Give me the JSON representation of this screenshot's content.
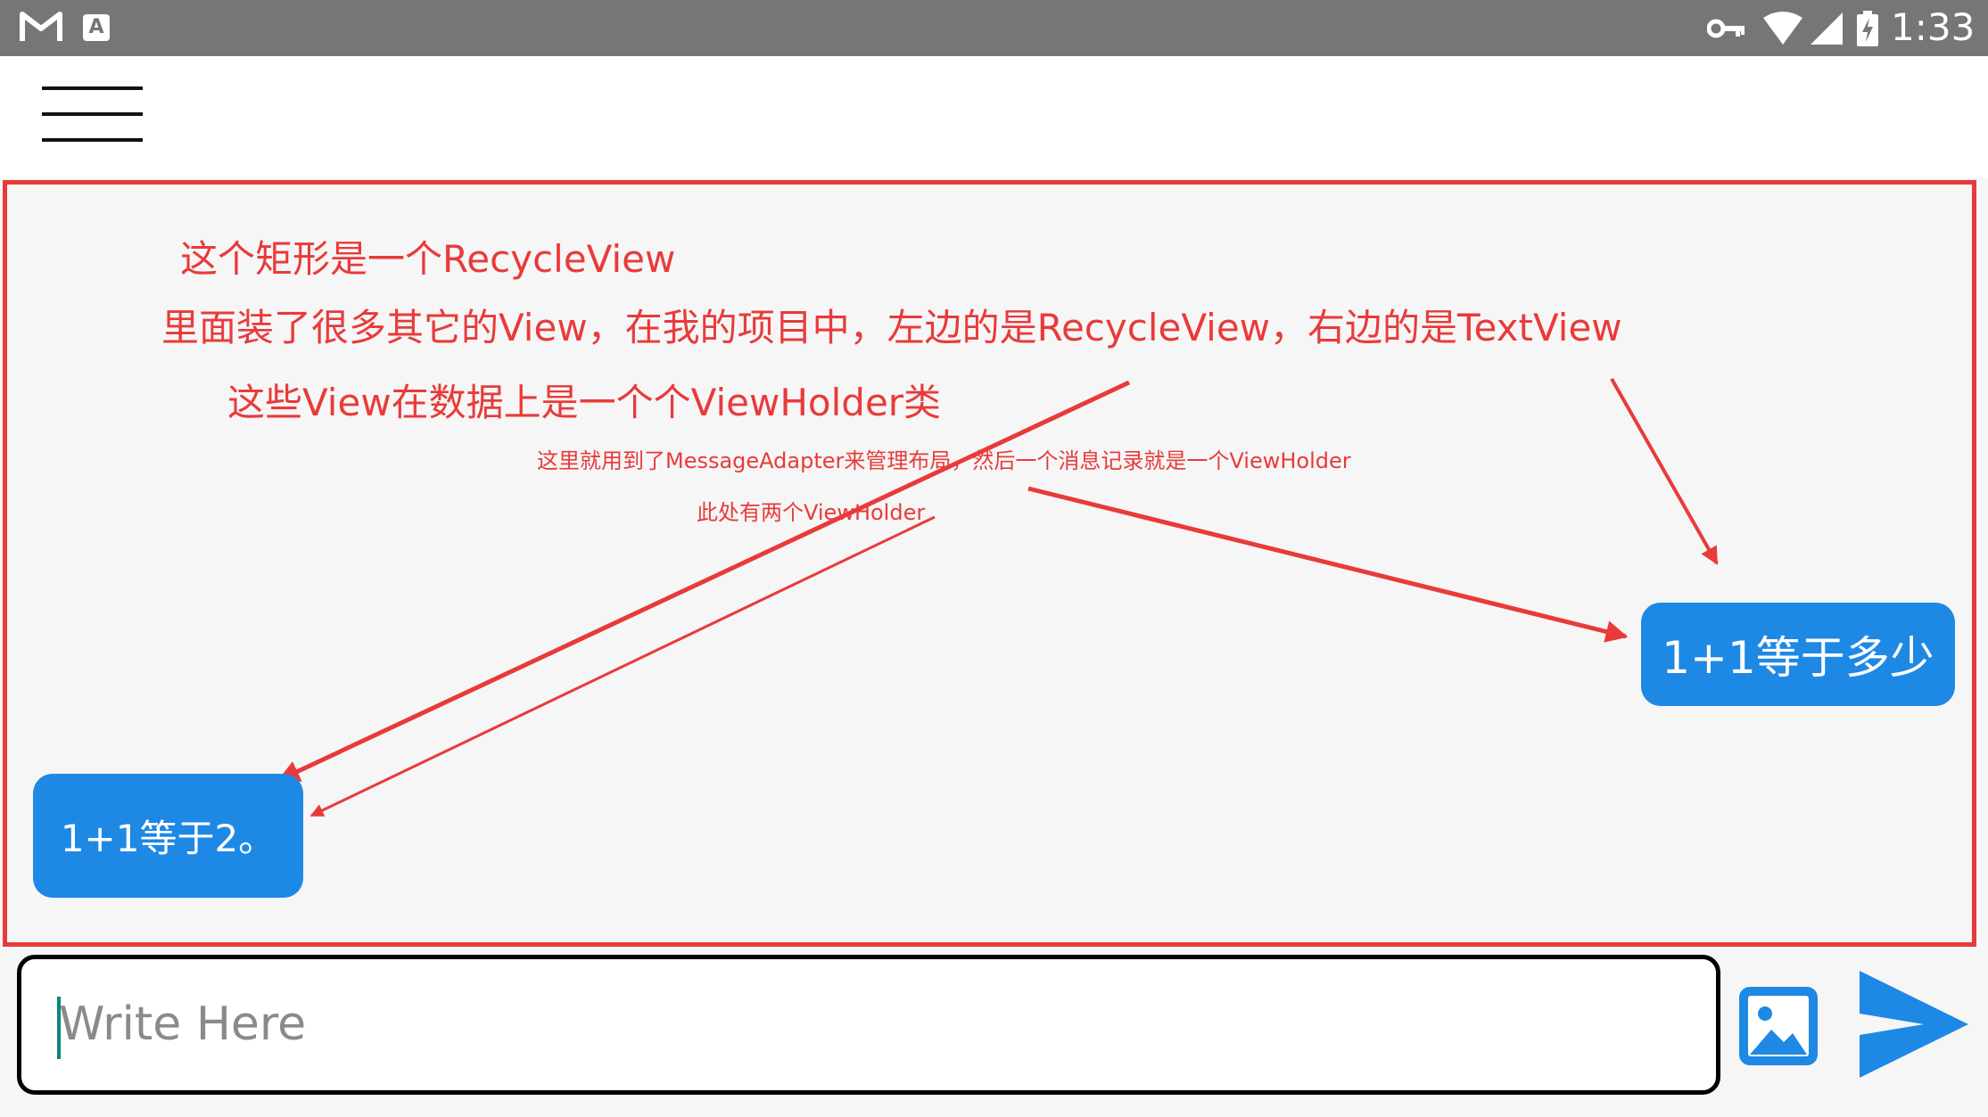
{
  "status_bar": {
    "time": "1:33",
    "notification_icons": [
      "gmail-icon",
      "text-a-icon"
    ],
    "system_icons": [
      "key-icon",
      "wifi-icon",
      "cell-signal-icon",
      "battery-charging-icon"
    ],
    "background_color": "#767676"
  },
  "toolbar": {
    "menu_icon": "hamburger-menu-icon"
  },
  "annotations": {
    "title": "这个矩形是一个RecycleView",
    "line2": "里面装了很多其它的View，在我的项目中，左边的是RecycleView，右边的是TextView",
    "line3": "这些View在数据上是一个个ViewHolder类",
    "note1": "这里就用到了MessageAdapter来管理布局，然后一个消息记录就是一个ViewHolder",
    "note2": "此处有两个ViewHolder",
    "color": "#e93a3a"
  },
  "messages": [
    {
      "side": "right",
      "text": "1+1等于多少"
    },
    {
      "side": "left",
      "text": "1+1等于2。"
    }
  ],
  "composer": {
    "placeholder": "Write Here",
    "value": "",
    "image_button_icon": "image-icon",
    "send_button_icon": "send-icon"
  },
  "colors": {
    "bubble": "#1e88e5",
    "accent": "#1e88e5",
    "annotation": "#e93a3a",
    "background": "#f6f6f6"
  }
}
